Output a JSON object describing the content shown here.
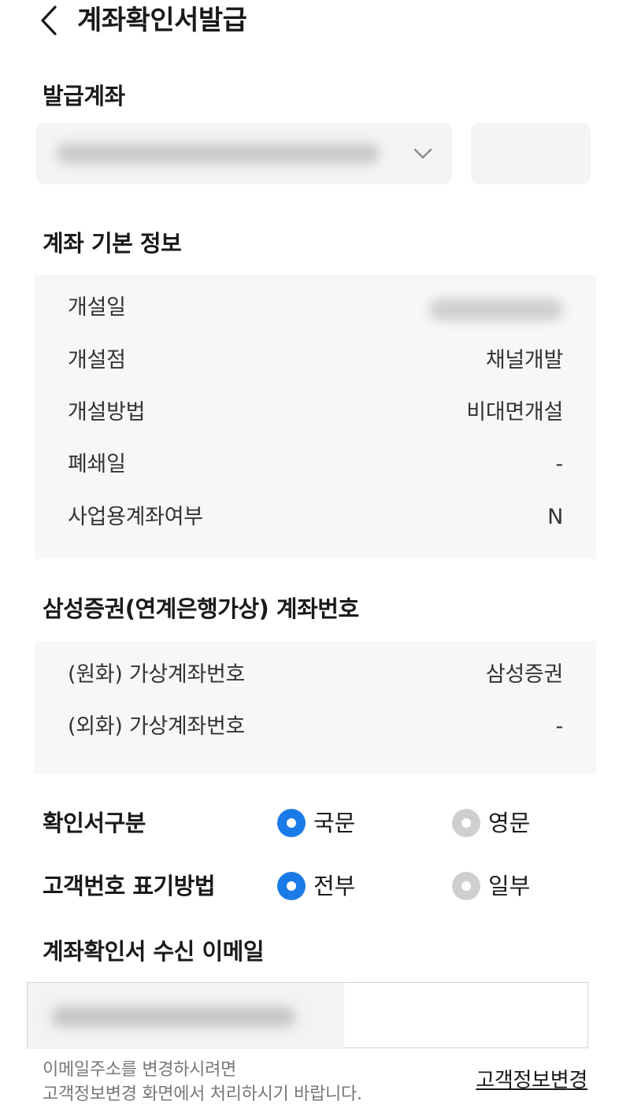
{
  "header": {
    "title": "계좌확인서발급",
    "back_icon": "chevron-left-icon"
  },
  "issue_account": {
    "title": "발급계좌",
    "select_icon": "chevron-down-icon"
  },
  "basic_info": {
    "title": "계좌 기본 정보",
    "rows": [
      {
        "label": "개설일",
        "value": ""
      },
      {
        "label": "개설점",
        "value": "채널개발"
      },
      {
        "label": "개설방법",
        "value": "비대면개설"
      },
      {
        "label": "폐쇄일",
        "value": "-"
      },
      {
        "label": "사업용계좌여부",
        "value": "N"
      }
    ]
  },
  "virtual_account": {
    "title": "삼성증권(연계은행가상) 계좌번호",
    "rows": [
      {
        "label": "(원화) 가상계좌번호",
        "value": "삼성증권"
      },
      {
        "label": "(외화) 가상계좌번호",
        "value": "-"
      }
    ]
  },
  "options": {
    "doc_type": {
      "label": "확인서구분",
      "choices": [
        {
          "label": "국문",
          "selected": true
        },
        {
          "label": "영문",
          "selected": false
        }
      ]
    },
    "customer_number": {
      "label": "고객번호 표기방법",
      "choices": [
        {
          "label": "전부",
          "selected": true
        },
        {
          "label": "일부",
          "selected": false
        }
      ]
    }
  },
  "email": {
    "title": "계좌확인서 수신 이메일",
    "notice_line1": "이메일주소를 변경하시려면",
    "notice_line2": "고객정보변경 화면에서 처리하시기 바랍니다.",
    "link_label": "고객정보변경"
  },
  "colors": {
    "accent": "#1a7ae8",
    "panel": "#f7f7f7",
    "field": "#f4f4f4"
  }
}
